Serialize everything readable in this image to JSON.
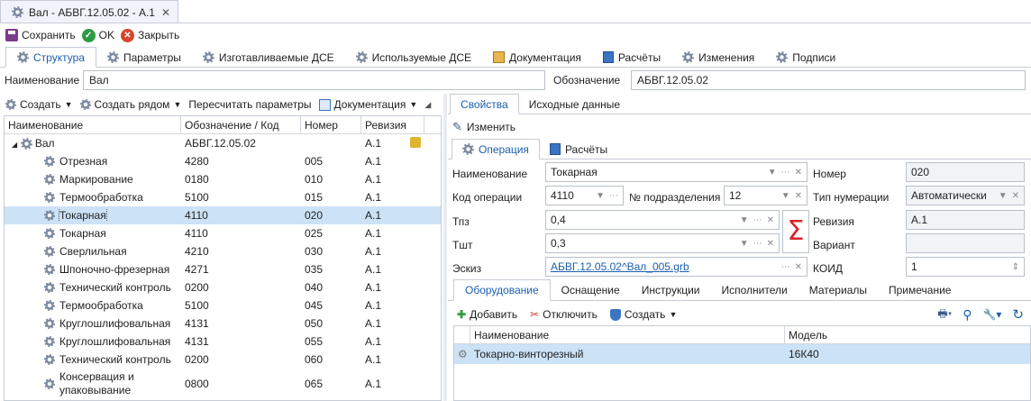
{
  "window": {
    "tab_title": "Вал - АБВГ.12.05.02 - А.1",
    "close_glyph": "✕"
  },
  "toolbar": {
    "save": "Сохранить",
    "ok": "OK",
    "close": "Закрыть"
  },
  "main_tabs": [
    "Структура",
    "Параметры",
    "Изготавливаемые ДСЕ",
    "Используемые ДСЕ",
    "Документация",
    "Расчёты",
    "Изменения",
    "Подписи"
  ],
  "header": {
    "name_label": "Наименование",
    "name_value": "Вал",
    "designation_label": "Обозначение",
    "designation_value": "АБВГ.12.05.02"
  },
  "left_toolbar": {
    "create": "Создать",
    "create_near": "Создать рядом",
    "recalc": "Пересчитать параметры",
    "docs": "Документация"
  },
  "tree": {
    "columns": [
      "Наименование",
      "Обозначение / Код",
      "Номер",
      "Ревизия"
    ],
    "root": {
      "name": "Вал",
      "code": "АБВГ.12.05.02",
      "num": "",
      "rev": "А.1"
    },
    "rows": [
      {
        "name": "Отрезная",
        "code": "4280",
        "num": "005",
        "rev": "А.1"
      },
      {
        "name": "Маркирование",
        "code": "0180",
        "num": "010",
        "rev": "А.1"
      },
      {
        "name": "Термообработка",
        "code": "5100",
        "num": "015",
        "rev": "А.1"
      },
      {
        "name": "Токарная",
        "code": "4110",
        "num": "020",
        "rev": "А.1"
      },
      {
        "name": "Токарная",
        "code": "4110",
        "num": "025",
        "rev": "А.1"
      },
      {
        "name": "Сверлильная",
        "code": "4210",
        "num": "030",
        "rev": "А.1"
      },
      {
        "name": "Шпоночно-фрезерная",
        "code": "4271",
        "num": "035",
        "rev": "А.1"
      },
      {
        "name": "Технический контроль",
        "code": "0200",
        "num": "040",
        "rev": "А.1"
      },
      {
        "name": "Термообработка",
        "code": "5100",
        "num": "045",
        "rev": "А.1"
      },
      {
        "name": "Круглошлифовальная",
        "code": "4131",
        "num": "050",
        "rev": "А.1"
      },
      {
        "name": "Круглошлифовальная",
        "code": "4131",
        "num": "055",
        "rev": "А.1"
      },
      {
        "name": "Технический контроль",
        "code": "0200",
        "num": "060",
        "rev": "А.1"
      },
      {
        "name": "Консервация и упаковывание",
        "code": "0800",
        "num": "065",
        "rev": "А.1"
      }
    ]
  },
  "right_tabs": [
    "Свойства",
    "Исходные данные"
  ],
  "edit_label": "Изменить",
  "op_tabs": [
    "Операция",
    "Расчёты"
  ],
  "form": {
    "name_label": "Наименование",
    "name_value": "Токарная",
    "code_label": "Код операции",
    "code_value": "4110",
    "dept_label": "№ подразделения",
    "dept_value": "12",
    "tpz_label": "Тпз",
    "tpz_value": "0,4",
    "tsht_label": "Тшт",
    "tsht_value": "0,3",
    "sketch_label": "Эскиз",
    "sketch_value": "АБВГ.12.05.02^Вал_005.grb",
    "num_label": "Номер",
    "num_value": "020",
    "numtype_label": "Тип нумерации",
    "numtype_value": "Автоматически",
    "rev_label": "Ревизия",
    "rev_value": "А.1",
    "variant_label": "Вариант",
    "variant_value": "",
    "koid_label": "КОИД",
    "koid_value": "1",
    "sigma": "Σ"
  },
  "eq_tabs": [
    "Оборудование",
    "Оснащение",
    "Инструкции",
    "Исполнители",
    "Материалы",
    "Примечание"
  ],
  "eq_toolbar": {
    "add": "Добавить",
    "detach": "Отключить",
    "create": "Создать"
  },
  "eq_grid": {
    "columns": [
      "Наименование",
      "Модель"
    ],
    "rows": [
      {
        "name": "Токарно-винторезный",
        "model": "16К40"
      }
    ]
  }
}
